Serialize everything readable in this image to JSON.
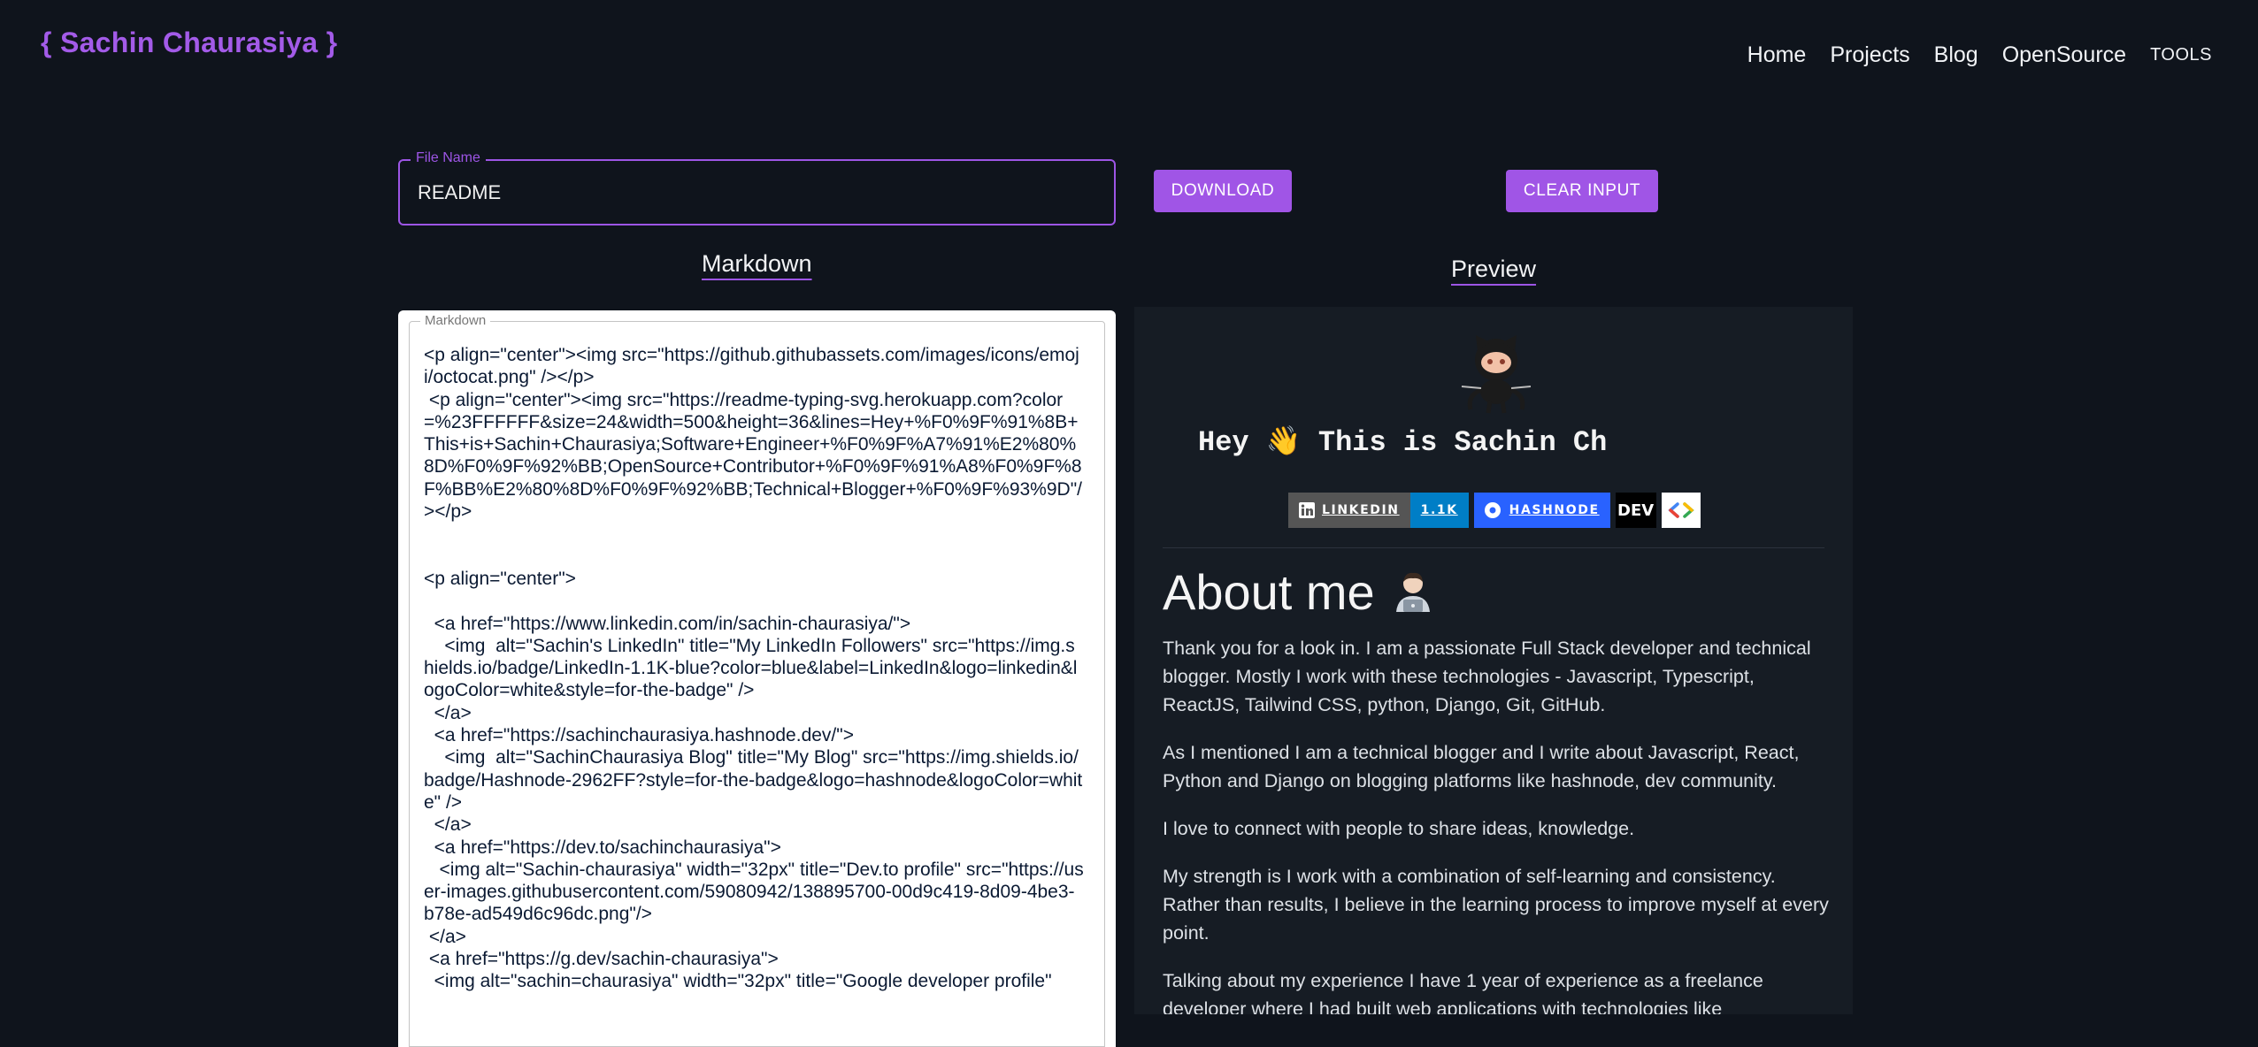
{
  "brand": "{ Sachin Chaurasiya }",
  "nav": {
    "home": "Home",
    "projects": "Projects",
    "blog": "Blog",
    "opensource": "OpenSource",
    "tools": "TOOLS"
  },
  "file_name": {
    "label": "File Name",
    "value": "README"
  },
  "buttons": {
    "download": "DOWNLOAD",
    "clear": "CLEAR INPUT"
  },
  "headings": {
    "markdown": "Markdown",
    "preview": "Preview"
  },
  "editor": {
    "label": "Markdown",
    "content": "<p align=\"center\"><img src=\"https://github.githubassets.com/images/icons/emoji/octocat.png\" /></p>\n <p align=\"center\"><img src=\"https://readme-typing-svg.herokuapp.com?color=%23FFFFFF&size=24&width=500&height=36&lines=Hey+%F0%9F%91%8B+This+is+Sachin+Chaurasiya;Software+Engineer+%F0%9F%A7%91%E2%80%8D%F0%9F%92%BB;OpenSource+Contributor+%F0%9F%91%A8%F0%9F%8F%BB%E2%80%8D%F0%9F%92%BB;Technical+Blogger+%F0%9F%93%9D\"/></p>\n\n\n<p align=\"center\">\n\n  <a href=\"https://www.linkedin.com/in/sachin-chaurasiya/\">\n    <img  alt=\"Sachin's LinkedIn\" title=\"My LinkedIn Followers\" src=\"https://img.shields.io/badge/LinkedIn-1.1K-blue?color=blue&label=LinkedIn&logo=linkedin&logoColor=white&style=for-the-badge\" />\n  </a>\n  <a href=\"https://sachinchaurasiya.hashnode.dev/\">\n    <img  alt=\"SachinChaurasiya Blog\" title=\"My Blog\" src=\"https://img.shields.io/badge/Hashnode-2962FF?style=for-the-badge&logo=hashnode&logoColor=white\" />\n  </a>\n  <a href=\"https://dev.to/sachinchaurasiya\">\n   <img alt=\"Sachin-chaurasiya\" width=\"32px\" title=\"Dev.to profile\" src=\"https://user-images.githubusercontent.com/59080942/138895700-00d9c419-8d09-4be3-b78e-ad549d6c96dc.png\"/>\n </a>\n <a href=\"https://g.dev/sachin-chaurasiya\">\n  <img alt=\"sachin=chaurasiya\" width=\"32px\" title=\"Google developer profile\""
  },
  "preview": {
    "typing_text": "Hey 👋 This is Sachin Ch",
    "badges": {
      "linkedin_label": "LINKEDIN",
      "linkedin_value": "1.1K",
      "hashnode_label": "HASHNODE",
      "dev_label": "DEV"
    },
    "about_heading": "About me",
    "paragraphs": [
      "Thank you for a look in. I am a passionate Full Stack developer and technical blogger. Mostly I work with these technologies - Javascript, Typescript, ReactJS, Tailwind CSS, python, Django, Git, GitHub.",
      "As I mentioned I am a technical blogger and I write about Javascript, React, Python and Django on blogging platforms like hashnode, dev community.",
      "I love to connect with people to share ideas, knowledge.",
      "My strength is I work with a combination of self-learning and consistency. Rather than results, I believe in the learning process to improve myself at every point.",
      "Talking about my experience I have 1 year of experience as a freelance developer where I had built web applications with technologies like"
    ]
  },
  "colors": {
    "accent": "#a055e6",
    "background": "#0f141c",
    "preview_bg": "#161c24",
    "linkedin_blue": "#007ec6",
    "hashnode_blue": "#2962ff"
  }
}
